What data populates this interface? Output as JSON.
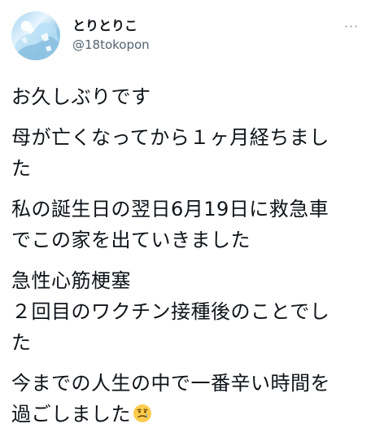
{
  "user": {
    "display_name": "とりとりこ",
    "handle": "@18tokopon",
    "more_label": "···"
  },
  "tweet": {
    "paragraphs": [
      [
        "お久しぶりです"
      ],
      [
        "母が亡くなってから１ヶ月経ちまし",
        "た"
      ],
      [
        "私の誕生日の翌日6月19日に救急車",
        "でこの家を出ていきました"
      ],
      [
        "急性心筋梗塞",
        "２回目のワクチン接種後のことでし",
        "た"
      ],
      [
        "今までの人生の中で一番辛い時間を",
        "過ごしました"
      ]
    ],
    "trailing_emoji": "crying-face-emoji"
  }
}
